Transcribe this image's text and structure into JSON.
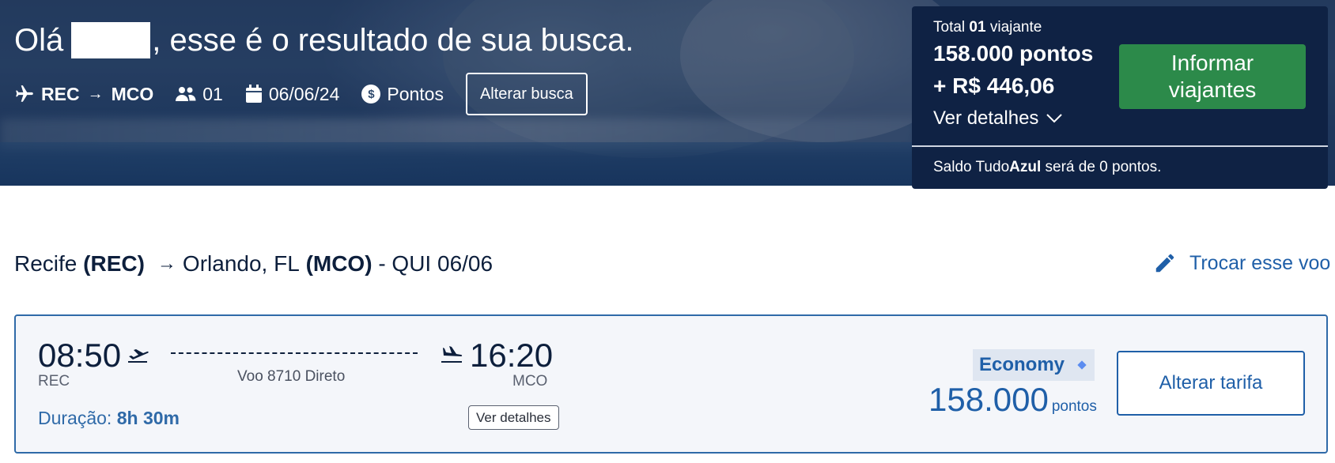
{
  "hero": {
    "greeting_prefix": "Olá",
    "greeting_suffix": ", esse é o resultado de sua busca.",
    "route_from": "REC",
    "route_arrow": "→",
    "route_to": "MCO",
    "passengers": "01",
    "date": "06/06/24",
    "payment_mode": "Pontos",
    "payment_icon_glyph": "$",
    "change_search_label": "Alterar busca"
  },
  "summary": {
    "travelers_prefix": "Total",
    "travelers_count": "01",
    "travelers_suffix": "viajante",
    "price_points": "158.000 pontos",
    "price_cash": "+ R$ 446,06",
    "details_label": "Ver detalhes",
    "cta_label": "Informar viajantes",
    "saldo_prefix": "Saldo Tudo",
    "saldo_brand": "Azul",
    "saldo_suffix": "será de 0 pontos."
  },
  "flight_header": {
    "origin_city": "Recife",
    "origin_code": "(REC)",
    "destination_city": "Orlando, FL",
    "destination_code": "(MCO)",
    "date_label": "- QUI 06/06",
    "change_flight_label": "Trocar esse voo"
  },
  "flight_card": {
    "departure_time": "08:50",
    "departure_code": "REC",
    "arrival_time": "16:20",
    "arrival_code": "MCO",
    "flight_info": "Voo 8710 Direto",
    "duration_label": "Duração:",
    "duration_value": "8h 30m",
    "details_button": "Ver detalhes",
    "fare_class": "Economy",
    "fare_points": "158.000",
    "fare_points_unit": "pontos",
    "change_fare_label": "Alterar tarifa"
  },
  "colors": {
    "brand_blue": "#1f5fa8",
    "navy_panel": "#0f2244",
    "cta_green": "#2c8a4a"
  }
}
